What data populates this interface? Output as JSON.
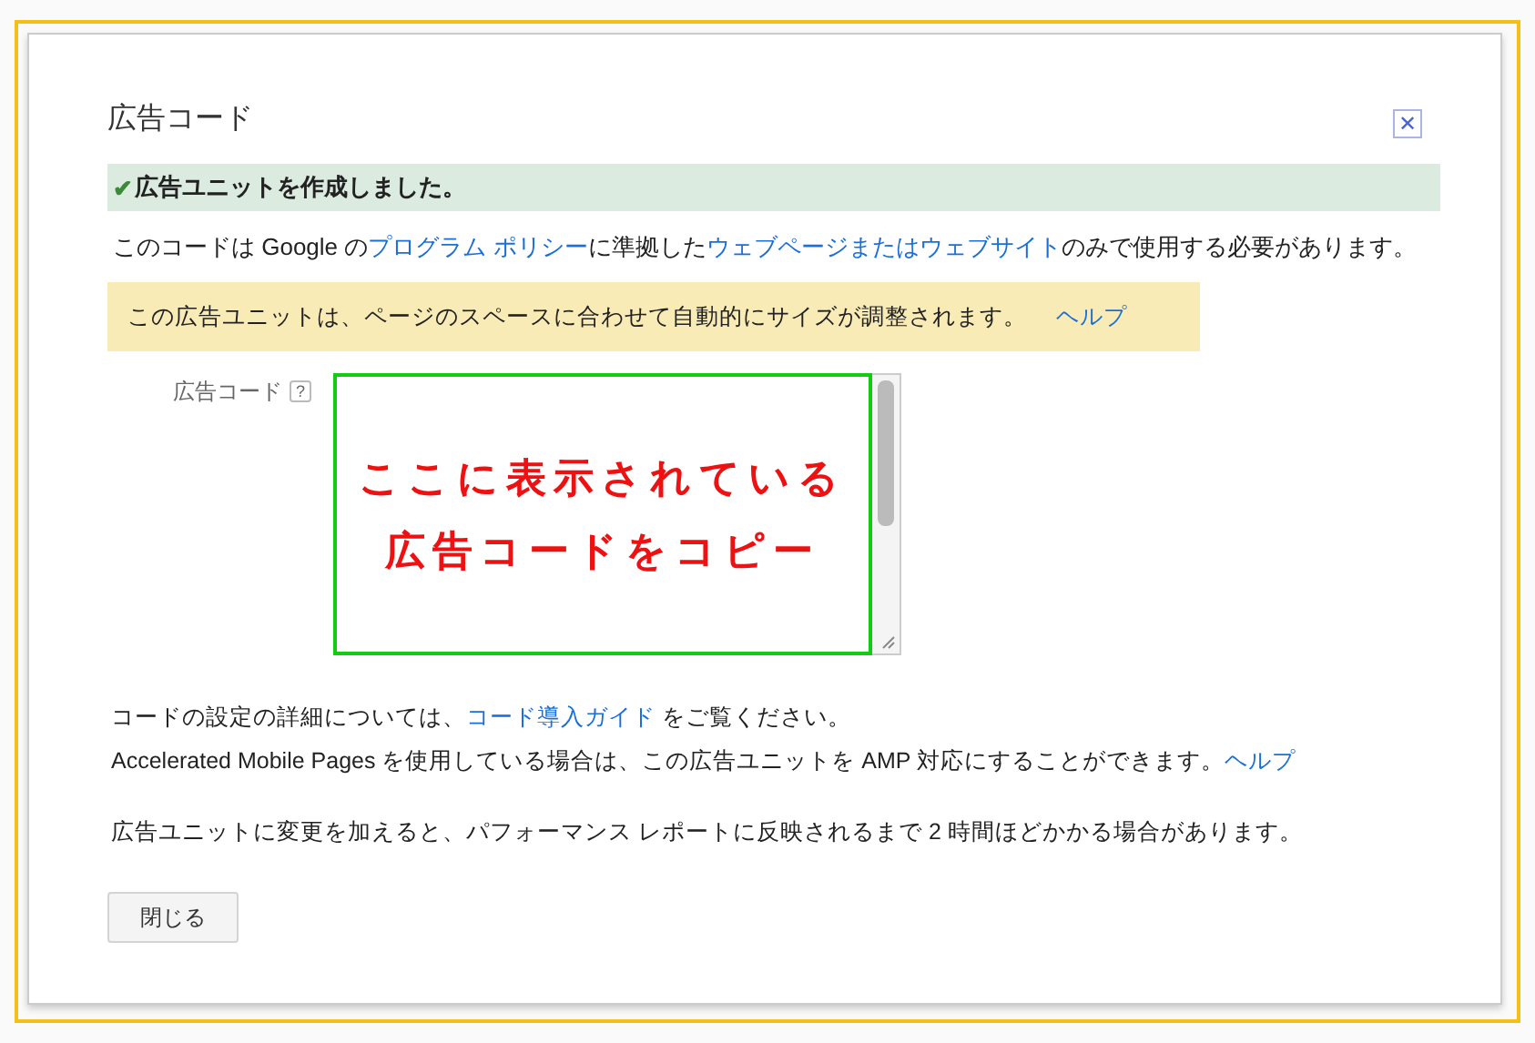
{
  "dialog": {
    "title": "広告コード",
    "close": "✕"
  },
  "success": {
    "check": "✔",
    "text": "広告ユニットを作成しました。"
  },
  "policy": [
    {
      "text": "このコードは Google の",
      "link": false
    },
    {
      "text": "プログラム ポリシー",
      "link": true
    },
    {
      "text": "に準拠した",
      "link": false
    },
    {
      "text": "ウェブページまたはウェブサイト",
      "link": true
    },
    {
      "text": "のみで使用する必要があります。",
      "link": false
    }
  ],
  "notice": {
    "text": "この広告ユニットは、ページのスペースに合わせて自動的にサイズが調整されます。",
    "link": "ヘルプ"
  },
  "code_field": {
    "label": "広告コード",
    "help": "?"
  },
  "annotation": {
    "lines": [
      "ここに表示されている",
      "広告コードをコピー"
    ]
  },
  "paragraphs": [
    [
      {
        "text": "コードの設定の詳細については、",
        "link": false
      },
      {
        "text": "コード導入ガイド",
        "link": true
      },
      {
        "text": " をご覧ください。",
        "link": false
      }
    ],
    [
      {
        "text": "Accelerated Mobile Pages を使用している場合は、この広告ユニットを AMP 対応にすることができます。",
        "link": false
      },
      {
        "text": "ヘルプ",
        "link": true
      }
    ]
  ],
  "note": "広告ユニットに変更を加えると、パフォーマンス レポートに反映されるまで 2 時間ほどかかる場合があります。",
  "buttons": [
    "閉じる"
  ]
}
